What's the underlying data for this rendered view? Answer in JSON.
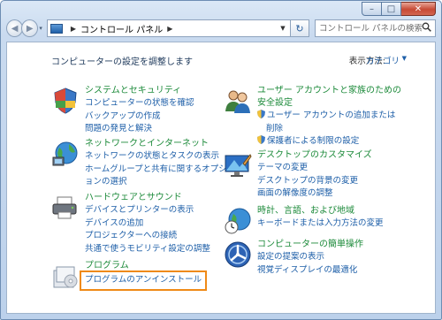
{
  "window": {
    "caption_buttons": {
      "minimize": "–",
      "maximize": "□",
      "close": "✕"
    }
  },
  "toolbar": {
    "back_glyph": "◀",
    "forward_glyph": "▶",
    "history_glyph": "▾",
    "address_segments": [
      "コントロール パネル"
    ],
    "search_placeholder": "コントロール パネルの検索",
    "refresh_glyph": "↻"
  },
  "content": {
    "page_title": "コンピューターの設定を調整します",
    "view_by_label": "表示方法:",
    "view_by_value": "カテゴリ",
    "categories_left": [
      {
        "title": "システムとセキュリティ",
        "links": [
          "コンピューターの状態を確認",
          "バックアップの作成",
          "問題の発見と解決"
        ]
      },
      {
        "title": "ネットワークとインターネット",
        "links": [
          "ネットワークの状態とタスクの表示",
          "ホームグループと共有に関するオプションの選択"
        ]
      },
      {
        "title": "ハードウェアとサウンド",
        "links": [
          "デバイスとプリンターの表示",
          "デバイスの追加",
          "プロジェクターへの接続",
          "共通で使うモビリティ設定の調整"
        ]
      },
      {
        "title": "プログラム",
        "links": [
          "プログラムのアンインストール"
        ]
      }
    ],
    "categories_right": [
      {
        "title_line1": "ユーザー アカウントと家族のための",
        "title_line2": "安全設定",
        "links": [
          "ユーザー アカウントの追加または",
          "削除",
          "保護者による制限の設定"
        ]
      },
      {
        "title": "デスクトップのカスタマイズ",
        "links": [
          "テーマの変更",
          "デスクトップの背景の変更",
          "画面の解像度の調整"
        ]
      },
      {
        "title": "時計、言語、および地域",
        "links": [
          "キーボードまたは入力方法の変更"
        ]
      },
      {
        "title": "コンピューターの簡単操作",
        "links": [
          "設定の提案の表示",
          "視覚ディスプレイの最適化"
        ]
      }
    ]
  },
  "colors": {
    "highlight": "#ef8a17",
    "title_green": "#1c8a3a",
    "link_blue": "#1e5fa8"
  }
}
